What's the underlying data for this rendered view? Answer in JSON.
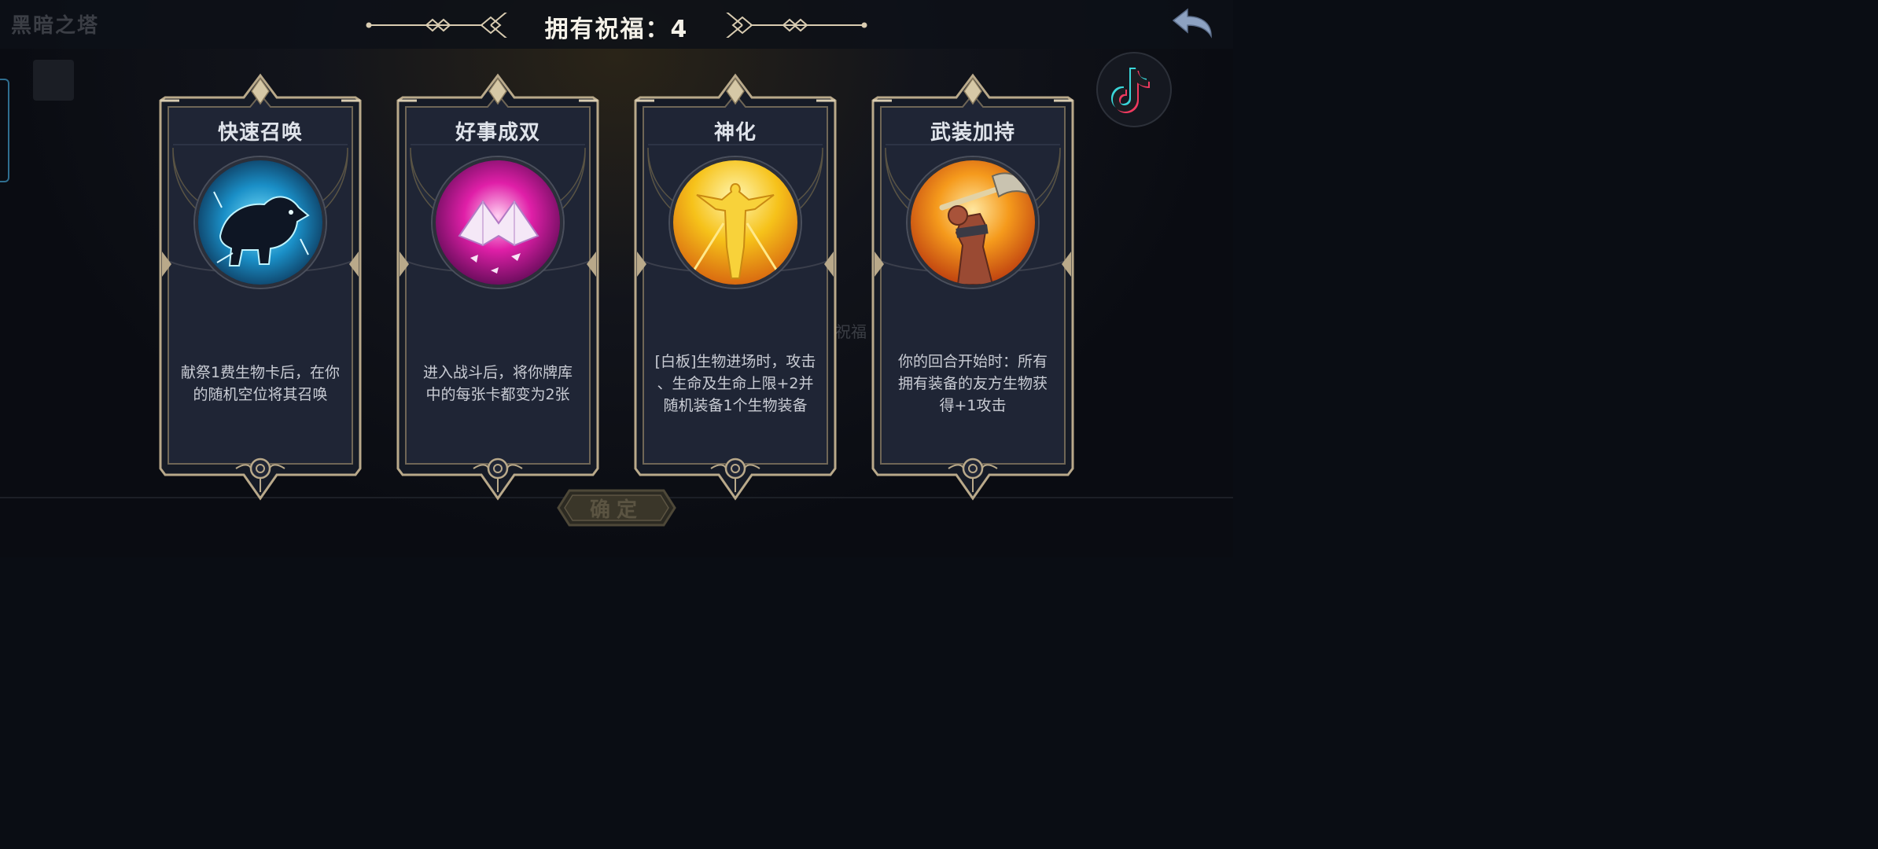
{
  "background": {
    "title": "黑暗之塔",
    "blessing_text": "祝福"
  },
  "header": {
    "title": "拥有祝福：4"
  },
  "icons": {
    "back": "back-arrow-icon",
    "tiktok": "tiktok-icon"
  },
  "cards": [
    {
      "title": "快速召唤",
      "icon": "spectral-boar-icon",
      "description": [
        "献祭1费生物卡后，在你",
        "的随机空位将其召唤"
      ]
    },
    {
      "title": "好事成双",
      "icon": "double-cards-icon",
      "description": [
        "进入战斗后，将你牌库",
        "中的每张卡都变为2张"
      ]
    },
    {
      "title": "神化",
      "icon": "golden-angel-icon",
      "description": [
        "[白板]生物进场时，攻击",
        "、生命及生命上限+2并",
        "随机装备1个生物装备"
      ]
    },
    {
      "title": "武装加持",
      "icon": "armed-fist-axe-icon",
      "description": [
        "你的回合开始时：所有",
        "拥有装备的友方生物获",
        "得+1攻击"
      ]
    }
  ],
  "confirm_button": {
    "label": "确定"
  },
  "colors": {
    "frame_gold": "#b9a98a",
    "card_body": "#1e2433",
    "title_text": "#dfe3ea"
  }
}
